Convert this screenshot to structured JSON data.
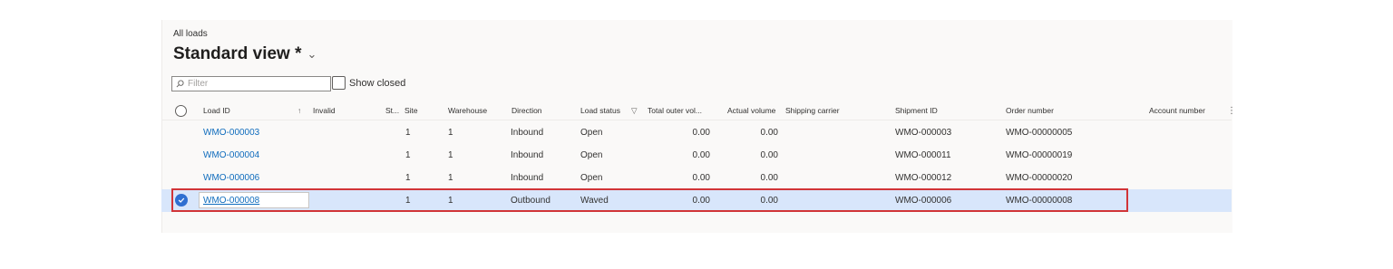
{
  "breadcrumb": "All loads",
  "view_title": "Standard view *",
  "filter": {
    "placeholder": "Filter"
  },
  "show_closed_label": "Show closed",
  "columns": {
    "load_id": "Load ID",
    "sort_glyph": "↑",
    "invalid": "Invalid",
    "st": "St...",
    "site": "Site",
    "warehouse": "Warehouse",
    "direction": "Direction",
    "load_status": "Load status",
    "filter_glyph": "▽",
    "total_outer_vol": "Total outer vol...",
    "actual_volume": "Actual volume",
    "shipping_carrier": "Shipping carrier",
    "shipment_id": "Shipment ID",
    "order_number": "Order number",
    "account_number": "Account number",
    "more_glyph": "⋮"
  },
  "rows": [
    {
      "load_id": "WMO-000003",
      "site": "1",
      "warehouse": "1",
      "direction": "Inbound",
      "status": "Open",
      "total_vol": "0.00",
      "actual_vol": "0.00",
      "shipment_id": "WMO-000003",
      "order_number": "WMO-00000005"
    },
    {
      "load_id": "WMO-000004",
      "site": "1",
      "warehouse": "1",
      "direction": "Inbound",
      "status": "Open",
      "total_vol": "0.00",
      "actual_vol": "0.00",
      "shipment_id": "WMO-000011",
      "order_number": "WMO-00000019"
    },
    {
      "load_id": "WMO-000006",
      "site": "1",
      "warehouse": "1",
      "direction": "Inbound",
      "status": "Open",
      "total_vol": "0.00",
      "actual_vol": "0.00",
      "shipment_id": "WMO-000012",
      "order_number": "WMO-00000020"
    },
    {
      "load_id": "WMO-000008",
      "site": "1",
      "warehouse": "1",
      "direction": "Outbound",
      "status": "Waved",
      "total_vol": "0.00",
      "actual_vol": "0.00",
      "shipment_id": "WMO-000006",
      "order_number": "WMO-00000008",
      "selected": true
    }
  ],
  "colors": {
    "link": "#0f6cbd",
    "selected_row": "#d8e6fb",
    "highlight": "#d13438",
    "check": "#2f6fd1"
  },
  "icons": {
    "filter": "search-icon",
    "view_menu": "chevron-down-icon",
    "selected": "checkmark-circle-icon"
  }
}
